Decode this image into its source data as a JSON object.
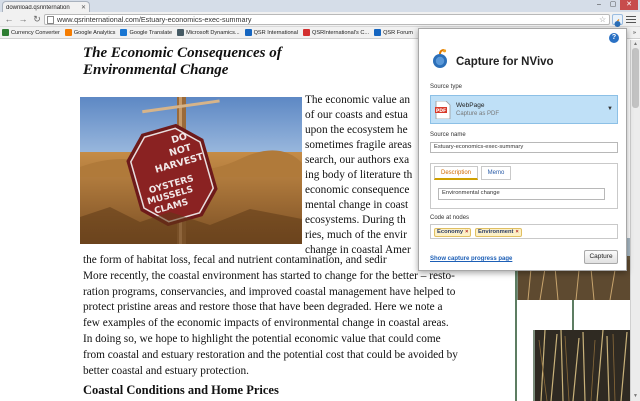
{
  "browser": {
    "tab_title": "download.qsrinternation",
    "url": "www.qsrinternational.com/Estuary-economics-exec-summary",
    "bookmarks": [
      {
        "label": "Currency Converter",
        "color": "#2e7d32"
      },
      {
        "label": "Google Analytics",
        "color": "#f57c00"
      },
      {
        "label": "Google Translate",
        "color": "#1976d2"
      },
      {
        "label": "Microsoft Dynamics...",
        "color": "#455a64"
      },
      {
        "label": "QSR International",
        "color": "#1565c0"
      },
      {
        "label": "QSRInternational's C...",
        "color": "#d32f2f"
      },
      {
        "label": "QSR Forum",
        "color": "#1565c0"
      }
    ],
    "bookmarks_more": "»"
  },
  "article": {
    "title": "The Economic Consequences of Environmental Change",
    "right_col_lines": [
      "The economic value an",
      "of our coasts and estua",
      "upon the ecosystem he",
      "sometimes fragile areas",
      "search, our authors exa",
      "ing body of literature th",
      "economic consequence",
      "mental change in coast",
      "ecosystems.  During th",
      "ries, much of the envir",
      "change in coastal Amer"
    ],
    "full_lines": [
      "the form of habitat loss, fecal and nutrient contamination, and sedir",
      "More recently, the coastal environment has started to change for the better – resto-",
      "ration programs, conservancies, and improved coastal management have helped to",
      "protect pristine areas and restore those that have been degraded.  Here we note a",
      "few examples of the economic impacts of environmental change in coastal areas.",
      "In doing so, we hope to highlight the potential economic value that could come",
      "from coastal and estuary restoration and the potential cost that could be avoided by",
      "better coastal and estuary protection."
    ],
    "section_heading": "Coastal Conditions and Home Prices",
    "sign_lines": [
      "DO",
      "NOT",
      "HARVEST",
      "OYSTERS",
      "MUSSELS",
      "CLAMS"
    ]
  },
  "popup": {
    "title": "Capture for NVivo",
    "help": "?",
    "source_type_label": "Source type",
    "source_type_name": "WebPage",
    "source_type_sub": "Capture as PDF",
    "source_name_label": "Source name",
    "source_name_value": "Estuary-economics-exec-summary",
    "tabs": [
      "Description",
      "Memo"
    ],
    "description_value": "Environmental change",
    "code_at_nodes_label": "Code at nodes",
    "nodes": [
      "Economy",
      "Environment"
    ],
    "remove_glyph": "×",
    "progress_link": "Show capture progress page",
    "capture_button": "Capture"
  }
}
